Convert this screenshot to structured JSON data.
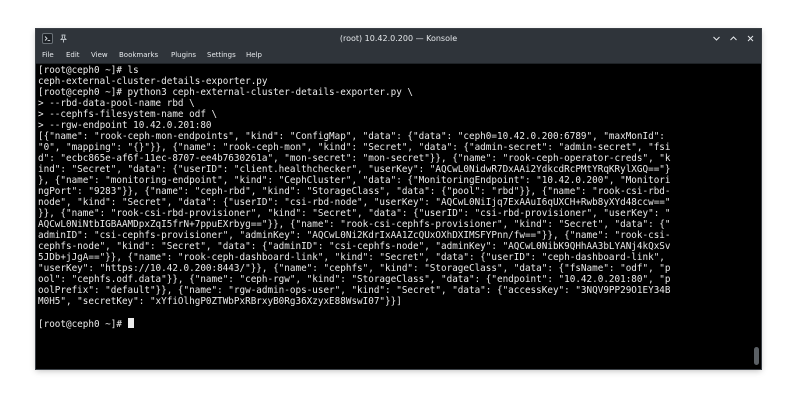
{
  "window": {
    "title": "(root) 10.42.0.200 — Konsole"
  },
  "menu": {
    "items": [
      "File",
      "Edit",
      "View",
      "Bookmarks",
      "Plugins",
      "Settings",
      "Help"
    ]
  },
  "terminal": {
    "lines": [
      "[root@ceph0 ~]# ls",
      "ceph-external-cluster-details-exporter.py",
      "[root@ceph0 ~]# python3 ceph-external-cluster-details-exporter.py \\",
      "> --rbd-data-pool-name rbd \\",
      "> --cephfs-filesystem-name odf \\",
      "> --rgw-endpoint 10.42.0.201:80",
      "[{\"name\": \"rook-ceph-mon-endpoints\", \"kind\": \"ConfigMap\", \"data\": {\"data\": \"ceph0=10.42.0.200:6789\", \"maxMonId\":",
      "\"0\", \"mapping\": \"{}\"}}, {\"name\": \"rook-ceph-mon\", \"kind\": \"Secret\", \"data\": {\"admin-secret\": \"admin-secret\", \"fsi",
      "d\": \"ecbc865e-af6f-11ec-8707-ee4b7630261a\", \"mon-secret\": \"mon-secret\"}}, {\"name\": \"rook-ceph-operator-creds\", \"k",
      "ind\": \"Secret\", \"data\": {\"userID\": \"client.healthchecker\", \"userKey\": \"AQCwL0NidwR7DxAAi2YdkcdRcPMtYRqKRylXGQ==\"}",
      "}, {\"name\": \"monitoring-endpoint\", \"kind\": \"CephCluster\", \"data\": {\"MonitoringEndpoint\": \"10.42.0.200\", \"Monitori",
      "ngPort\": \"9283\"}}, {\"name\": \"ceph-rbd\", \"kind\": \"StorageClass\", \"data\": {\"pool\": \"rbd\"}}, {\"name\": \"rook-csi-rbd-",
      "node\", \"kind\": \"Secret\", \"data\": {\"userID\": \"csi-rbd-node\", \"userKey\": \"AQCwL0NiIjq7ExAAuI6qUXCH+Rwb8yXYd48ccw==\"",
      "}}, {\"name\": \"rook-csi-rbd-provisioner\", \"kind\": \"Secret\", \"data\": {\"userID\": \"csi-rbd-provisioner\", \"userKey\": \"",
      "AQCwL0NiNtbIGBAAMDpxZqI5frN+7ppuEXrbyg==\"}}, {\"name\": \"rook-csi-cephfs-provisioner\", \"kind\": \"Secret\", \"data\": {\"",
      "adminID\": \"csi-cephfs-provisioner\", \"adminKey\": \"AQCwL0Ni2KdrIxAA1ZcQUxOXhDXIMSFYPnn/fw==\"}}, {\"name\": \"rook-csi-",
      "cephfs-node\", \"kind\": \"Secret\", \"data\": {\"adminID\": \"csi-cephfs-node\", \"adminKey\": \"AQCwL0NibK9QHhAA3bLYANj4kQxSv",
      "5JDb+jJgA==\"}}, {\"name\": \"rook-ceph-dashboard-link\", \"kind\": \"Secret\", \"data\": {\"userID\": \"ceph-dashboard-link\",",
      "\"userKey\": \"https://10.42.0.200:8443/\"}}, {\"name\": \"cephfs\", \"kind\": \"StorageClass\", \"data\": {\"fsName\": \"odf\", \"p",
      "ool\": \"cephfs.odf.data\"}}, {\"name\": \"ceph-rgw\", \"kind\": \"StorageClass\", \"data\": {\"endpoint\": \"10.42.0.201:80\", \"p",
      "oolPrefix\": \"default\"}}, {\"name\": \"rgw-admin-ops-user\", \"kind\": \"Secret\", \"data\": {\"accessKey\": \"3NQV9PP29O1EY34B",
      "M0H5\", \"secretKey\": \"xYfiOlhgP0ZTWbPxRBrxyB0Rg36XzyxE88WswI07\"}}]",
      "",
      "[root@ceph0 ~]# "
    ]
  },
  "icons": {
    "app": "terminal-app-icon",
    "pin": "pin-icon",
    "minimize": "chevron-down-icon",
    "maximize": "chevron-up-icon",
    "close": "close-icon"
  },
  "colors": {
    "titlebar": "#2f343a",
    "terminal_bg": "#000000",
    "terminal_fg": "#ebebeb"
  }
}
